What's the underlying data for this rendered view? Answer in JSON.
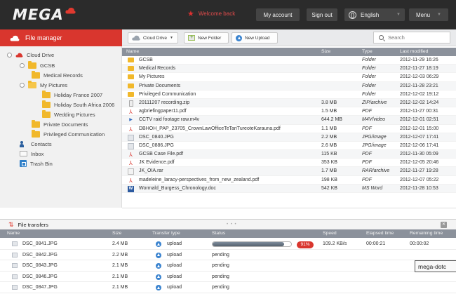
{
  "topbar": {
    "logo": "MEGA",
    "welcome": "Welcome back",
    "account": "My account",
    "signout": "Sign out",
    "language": "English",
    "menu": "Menu"
  },
  "sidebar": {
    "header": "File manager",
    "items": [
      {
        "label": "Cloud Drive"
      },
      {
        "label": "GCSB"
      },
      {
        "label": "Medical Records"
      },
      {
        "label": "My Pictures"
      },
      {
        "label": "Holiday France 2007"
      },
      {
        "label": "Holiday South Africa 2006"
      },
      {
        "label": "Wedding Pictures"
      },
      {
        "label": "Private Documents"
      },
      {
        "label": "Privileged Communication"
      },
      {
        "label": "Contacts"
      },
      {
        "label": "Inbox"
      },
      {
        "label": "Trash Bin"
      }
    ]
  },
  "toolbar": {
    "cloud_drive": "Cloud Drive",
    "new_folder": "New Folder",
    "new_upload": "New Upload",
    "search_placeholder": "Search"
  },
  "files": {
    "columns": [
      "Name",
      "Size",
      "Type",
      "Last modified"
    ],
    "rows": [
      {
        "icon": "folder",
        "name": "GCSB",
        "size": "",
        "type": "Folder",
        "modified": "2012-11-29 16:26"
      },
      {
        "icon": "folder",
        "name": "Medical Records",
        "size": "",
        "type": "Folder",
        "modified": "2012-11-27 18:19"
      },
      {
        "icon": "folder",
        "name": "My Pictures",
        "size": "",
        "type": "Folder",
        "modified": "2012-12-03 06:29"
      },
      {
        "icon": "folder",
        "name": "Private Documents",
        "size": "",
        "type": "Folder",
        "modified": "2012-11-28 23:21"
      },
      {
        "icon": "folder",
        "name": "Privileged Communication",
        "size": "",
        "type": "Folder",
        "modified": "2012-12-02 19:12"
      },
      {
        "icon": "zip",
        "name": "20111207 recording.zip",
        "size": "3.8 MB",
        "type": "ZIP/archive",
        "modified": "2012-12-02 14:24"
      },
      {
        "icon": "pdf",
        "name": "agbriefingpaper11.pdf",
        "size": "1.5 MB",
        "type": "PDF",
        "modified": "2012-11-27 00:31"
      },
      {
        "icon": "video",
        "name": "CCTV raid footage raw.m4v",
        "size": "644.2 MB",
        "type": "M4V/video",
        "modified": "2012-12-01 02:51"
      },
      {
        "icon": "pdf",
        "name": "DBHOH_PAP_23705_CrownLawOfficeTeTariTureoteKarauna.pdf",
        "size": "1.1 MB",
        "type": "PDF",
        "modified": "2012-12-01 15:00"
      },
      {
        "icon": "image",
        "name": "DSC_0840.JPG",
        "size": "2.2 MB",
        "type": "JPG/image",
        "modified": "2012-12-07 17:41"
      },
      {
        "icon": "image",
        "name": "DSC_0886.JPG",
        "size": "2.6 MB",
        "type": "JPG/image",
        "modified": "2012-12-06 17:41"
      },
      {
        "icon": "pdf",
        "name": "GCSB Case File.pdf",
        "size": "115 KB",
        "type": "PDF",
        "modified": "2012-11-30 05:09"
      },
      {
        "icon": "pdf",
        "name": "JK Evidence.pdf",
        "size": "353 KB",
        "type": "PDF",
        "modified": "2012-12-05 20:46"
      },
      {
        "icon": "rar",
        "name": "JK_OIA.rar",
        "size": "1.7 MB",
        "type": "RAR/archive",
        "modified": "2012-11-27 19:28"
      },
      {
        "icon": "pdf",
        "name": "madeleine_laracy-perspectives_from_new_zealand.pdf",
        "size": "198 KB",
        "type": "PDF",
        "modified": "2012-12-07 05:22"
      },
      {
        "icon": "doc",
        "name": "Wormald_Burgess_Chronology.doc",
        "size": "542 KB",
        "type": "MS Word",
        "modified": "2012-11-28 10:53"
      }
    ]
  },
  "transfers": {
    "title": "File transfers",
    "drag_handle": "• • •",
    "columns": [
      "Name",
      "Size",
      "Transfer type",
      "Status",
      "Speed",
      "Elapsed time",
      "Remaining time"
    ],
    "rows": [
      {
        "name": "DSC_0841.JPG",
        "size": "2.4 MB",
        "type": "upload",
        "status": "",
        "progress": 0.91,
        "percent": "91%",
        "speed": "109.2 KB/s",
        "elapsed": "00:00:21",
        "remaining": "00:00:02"
      },
      {
        "name": "DSC_0842.JPG",
        "size": "2.2 MB",
        "type": "upload",
        "status": "pending",
        "speed": "",
        "elapsed": "",
        "remaining": ""
      },
      {
        "name": "DSC_0843.JPG",
        "size": "2.1 MB",
        "type": "upload",
        "status": "pending",
        "speed": "",
        "elapsed": "",
        "remaining": ""
      },
      {
        "name": "DSC_0846.JPG",
        "size": "2.1 MB",
        "type": "upload",
        "status": "pending",
        "speed": "",
        "elapsed": "",
        "remaining": ""
      },
      {
        "name": "DSC_0847.JPG",
        "size": "2.1 MB",
        "type": "upload",
        "status": "pending",
        "speed": "",
        "elapsed": "",
        "remaining": ""
      }
    ]
  },
  "tooltip": "mega-dotc",
  "colors": {
    "brand_red": "#d9362e",
    "topbar": "#2b2b2b",
    "header_gray": "#8b919b"
  }
}
